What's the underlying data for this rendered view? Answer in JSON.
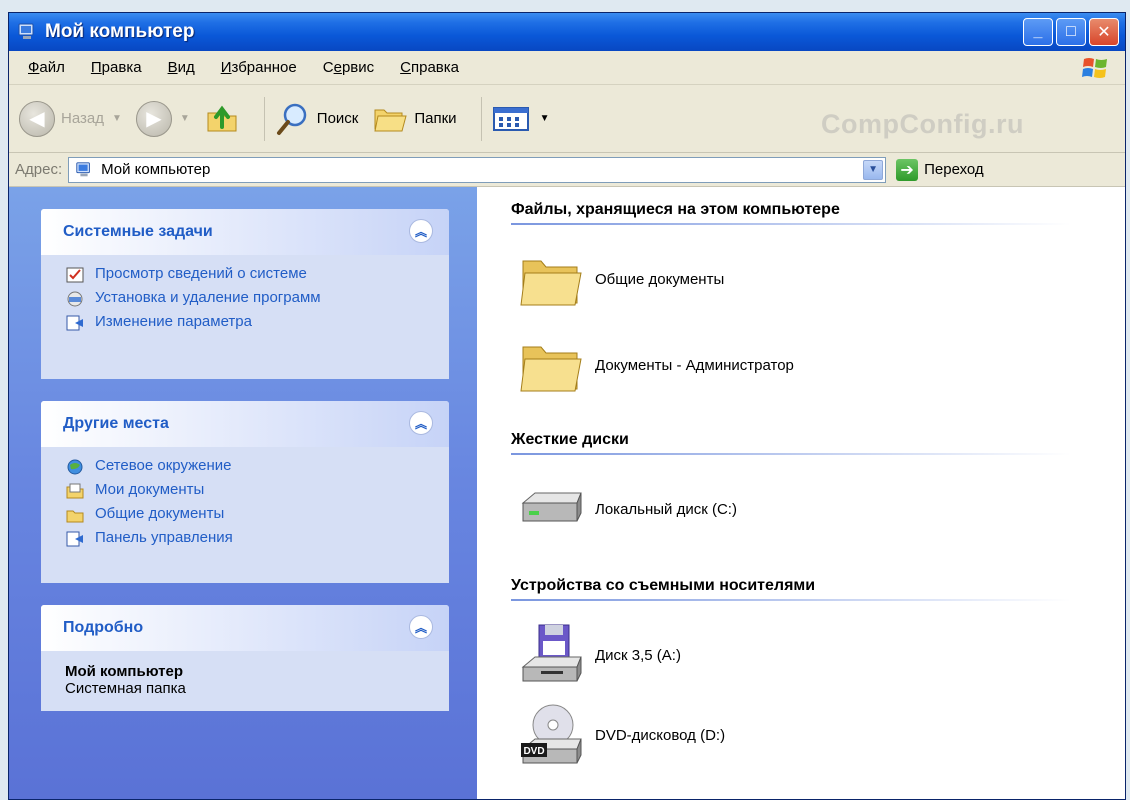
{
  "window": {
    "title": "Мой компьютер"
  },
  "menubar": {
    "items": [
      {
        "label": "Файл",
        "key": "Ф",
        "rest": "айл"
      },
      {
        "label": "Правка",
        "key": "П",
        "rest": "равка"
      },
      {
        "label": "Вид",
        "key": "В",
        "rest": "ид"
      },
      {
        "label": "Избранное",
        "key": "И",
        "rest": "збранное"
      },
      {
        "label": "Сервис",
        "key": "е",
        "pre": "С",
        "rest": "рвис"
      },
      {
        "label": "Справка",
        "key": "С",
        "rest": "правка"
      }
    ]
  },
  "toolbar": {
    "back_label": "Назад",
    "search_label": "Поиск",
    "folders_label": "Папки"
  },
  "watermark": "CompConfig.ru",
  "address": {
    "label": "Адрес:",
    "value": "Мой компьютер",
    "go_label": "Переход"
  },
  "sidebar": {
    "system_tasks": {
      "title": "Системные задачи",
      "items": [
        "Просмотр сведений о системе",
        "Установка и удаление программ",
        "Изменение параметра"
      ]
    },
    "other_places": {
      "title": "Другие места",
      "items": [
        "Сетевое окружение",
        "Мои документы",
        "Общие документы",
        "Панель управления"
      ]
    },
    "details": {
      "title": "Подробно",
      "name": "Мой компьютер",
      "type": "Системная папка"
    }
  },
  "content": {
    "files_section": {
      "title": "Файлы, хранящиеся на этом компьютере",
      "items": [
        "Общие документы",
        "Документы - Администратор"
      ]
    },
    "hard_disks": {
      "title": "Жесткие диски",
      "items": [
        "Локальный диск (C:)"
      ]
    },
    "removable": {
      "title": "Устройства со съемными носителями",
      "items": [
        "Диск 3,5 (A:)",
        "DVD-дисковод (D:)"
      ]
    }
  },
  "colors": {
    "titlebar": "#0a58d8",
    "sidebar": "#6785e0",
    "panel_title": "#215dc6",
    "chrome": "#ece9d8"
  }
}
